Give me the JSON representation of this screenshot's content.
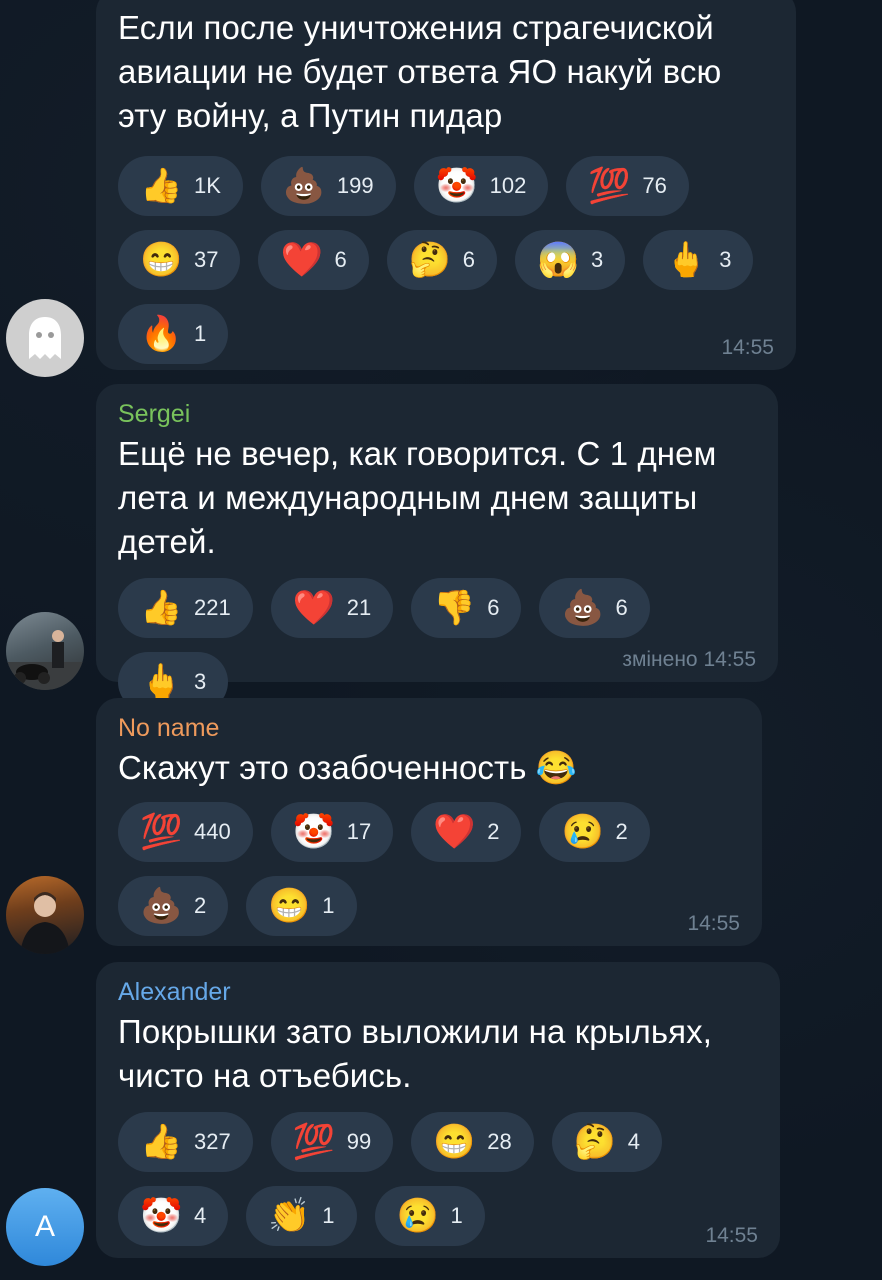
{
  "messages": [
    {
      "sender": "",
      "text_lines": [
        "Если после уничтожения  страгечиской",
        "авиации не будет ответа ЯО накуй всю",
        "эту войну, а Путин пидар"
      ],
      "reactions": [
        {
          "emoji": "👍",
          "count": "1K"
        },
        {
          "emoji": "💩",
          "count": "199"
        },
        {
          "emoji": "🤡",
          "count": "102"
        },
        {
          "emoji": "💯",
          "count": "76"
        },
        {
          "emoji": "😁",
          "count": "37"
        },
        {
          "emoji": "❤️",
          "count": "6"
        },
        {
          "emoji": "🤔",
          "count": "6"
        },
        {
          "emoji": "😱",
          "count": "3"
        },
        {
          "emoji": "🖕",
          "count": "3"
        },
        {
          "emoji": "🔥",
          "count": "1"
        }
      ],
      "time": "14:55"
    },
    {
      "sender": "Sergei",
      "sender_color": "#79c35c",
      "text_lines": [
        "Ещё не вечер, как говорится. С 1 днем",
        "лета и международным днем защиты",
        "детей."
      ],
      "reactions": [
        {
          "emoji": "👍",
          "count": "221"
        },
        {
          "emoji": "❤️",
          "count": "21"
        },
        {
          "emoji": "👎",
          "count": "6"
        },
        {
          "emoji": "💩",
          "count": "6"
        },
        {
          "emoji": "🖕",
          "count": "3"
        }
      ],
      "time": "змінено 14:55"
    },
    {
      "sender": "No name",
      "sender_color": "#ee9a5c",
      "text_lines": [
        "Скажут это озабоченность 😂"
      ],
      "reactions": [
        {
          "emoji": "💯",
          "count": "440"
        },
        {
          "emoji": "🤡",
          "count": "17"
        },
        {
          "emoji": "❤️",
          "count": "2"
        },
        {
          "emoji": "😢",
          "count": "2"
        },
        {
          "emoji": "💩",
          "count": "2"
        },
        {
          "emoji": "😁",
          "count": "1"
        }
      ],
      "time": "14:55"
    },
    {
      "sender": "Alexander",
      "sender_color": "#66a8e8",
      "text_lines": [
        "Покрышки зато выложили на крыльях,",
        "чисто на отъебись."
      ],
      "reactions": [
        {
          "emoji": "👍",
          "count": "327"
        },
        {
          "emoji": "💯",
          "count": "99"
        },
        {
          "emoji": "😁",
          "count": "28"
        },
        {
          "emoji": "🤔",
          "count": "4"
        },
        {
          "emoji": "🤡",
          "count": "4"
        },
        {
          "emoji": "👏",
          "count": "1"
        },
        {
          "emoji": "😢",
          "count": "1"
        }
      ],
      "time": "14:55",
      "avatar_letter": "A"
    }
  ],
  "avatar_icons": [
    "ghost-icon",
    "user-photo",
    "user-photo",
    "letter-avatar"
  ]
}
